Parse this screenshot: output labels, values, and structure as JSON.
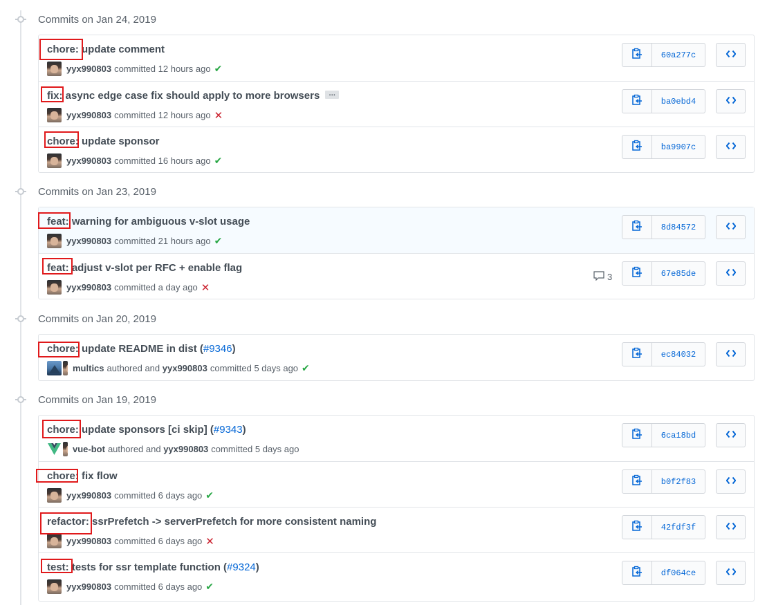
{
  "groups": [
    {
      "title": "Commits on Jan 24, 2019",
      "commits": [
        {
          "type": "chore:",
          "message": "update comment",
          "pr": "",
          "author": "yyx990803",
          "action": "committed",
          "time": "12 hours ago",
          "status": "success",
          "sha": "60a277c"
        },
        {
          "type": "fix:",
          "message": "async edge case fix should apply to more browsers",
          "pr": "",
          "ellipsis": "…",
          "author": "yyx990803",
          "action": "committed",
          "time": "12 hours ago",
          "status": "failure",
          "sha": "ba0ebd4"
        },
        {
          "type": "chore:",
          "message": "update sponsor",
          "pr": "",
          "author": "yyx990803",
          "action": "committed",
          "time": "16 hours ago",
          "status": "success",
          "sha": "ba9907c"
        }
      ]
    },
    {
      "title": "Commits on Jan 23, 2019",
      "commits": [
        {
          "type": "feat:",
          "message": "warning for ambiguous v-slot usage",
          "pr": "",
          "author": "yyx990803",
          "action": "committed",
          "time": "21 hours ago",
          "status": "success",
          "sha": "8d84572"
        },
        {
          "type": "feat:",
          "message": "adjust v-slot per RFC + enable flag",
          "pr": "",
          "author": "yyx990803",
          "action": "committed",
          "time": "a day ago",
          "status": "failure",
          "sha": "67e85de",
          "comments": "3"
        }
      ]
    },
    {
      "title": "Commits on Jan 20, 2019",
      "commits": [
        {
          "type": "chore:",
          "message": "update README in dist (",
          "pr": "#9346",
          "close": ")",
          "co_author": "multics",
          "authored": "authored and",
          "author": "yyx990803",
          "action": "committed",
          "time": "5 days ago",
          "status": "success",
          "sha": "ec84032"
        }
      ]
    },
    {
      "title": "Commits on Jan 19, 2019",
      "commits": [
        {
          "type": "chore:",
          "message": "update sponsors [ci skip] (",
          "pr": "#9343",
          "close": ")",
          "co_author": "vue-bot",
          "authored": "authored and",
          "author": "yyx990803",
          "action": "committed",
          "time": "5 days ago",
          "status": "none",
          "sha": "6ca18bd"
        },
        {
          "type": "chore:",
          "message": "fix flow",
          "pr": "",
          "author": "yyx990803",
          "action": "committed",
          "time": "6 days ago",
          "status": "success",
          "sha": "b0f2f83"
        },
        {
          "type": "refactor:",
          "message": "ssrPrefetch -> serverPrefetch for more consistent naming",
          "pr": "",
          "author": "yyx990803",
          "action": "committed",
          "time": "6 days ago",
          "status": "failure",
          "sha": "42fdf3f"
        },
        {
          "type": "test:",
          "message": "tests for ssr template function (",
          "pr": "#9324",
          "close": ")",
          "author": "yyx990803",
          "action": "committed",
          "time": "6 days ago",
          "status": "success",
          "sha": "df064ce"
        }
      ]
    }
  ],
  "icons": {
    "copy": "clipboard-icon",
    "browse": "code-icon",
    "success": "check-icon",
    "failure": "x-icon",
    "comments": "comment-icon"
  },
  "colors": {
    "link": "#0366d6",
    "success": "#28a745",
    "failure": "#cb2431",
    "highlight": "#e0191b",
    "border": "#e1e4e8"
  }
}
